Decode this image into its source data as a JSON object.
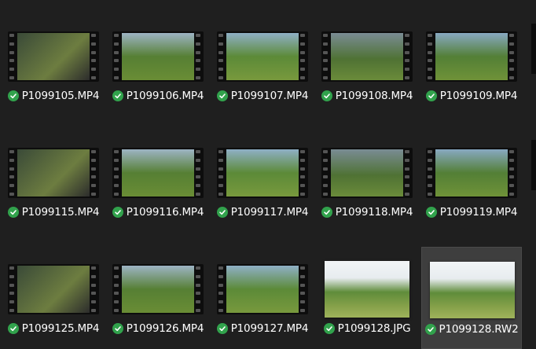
{
  "files": [
    {
      "name": "P1099105.MP4",
      "type": "video",
      "status": "synced"
    },
    {
      "name": "P1099106.MP4",
      "type": "video",
      "status": "synced"
    },
    {
      "name": "P1099107.MP4",
      "type": "video",
      "status": "synced"
    },
    {
      "name": "P1099108.MP4",
      "type": "video",
      "status": "synced"
    },
    {
      "name": "P1099109.MP4",
      "type": "video",
      "status": "synced"
    },
    {
      "name": "P1099115.MP4",
      "type": "video",
      "status": "synced"
    },
    {
      "name": "P1099116.MP4",
      "type": "video",
      "status": "synced"
    },
    {
      "name": "P1099117.MP4",
      "type": "video",
      "status": "synced"
    },
    {
      "name": "P1099118.MP4",
      "type": "video",
      "status": "synced"
    },
    {
      "name": "P1099119.MP4",
      "type": "video",
      "status": "synced"
    },
    {
      "name": "P1099125.MP4",
      "type": "video",
      "status": "synced"
    },
    {
      "name": "P1099126.MP4",
      "type": "video",
      "status": "synced"
    },
    {
      "name": "P1099127.MP4",
      "type": "video",
      "status": "synced"
    },
    {
      "name": "P1099128.JPG",
      "type": "image",
      "status": "synced"
    },
    {
      "name": "P1099128.RW2",
      "type": "image",
      "status": "synced",
      "selected": true
    }
  ],
  "colors": {
    "background": "#1f1f1f",
    "selection": "#3e3e3e",
    "status_ok": "#31a24c"
  },
  "icons": {
    "status": "check-circle-icon"
  }
}
